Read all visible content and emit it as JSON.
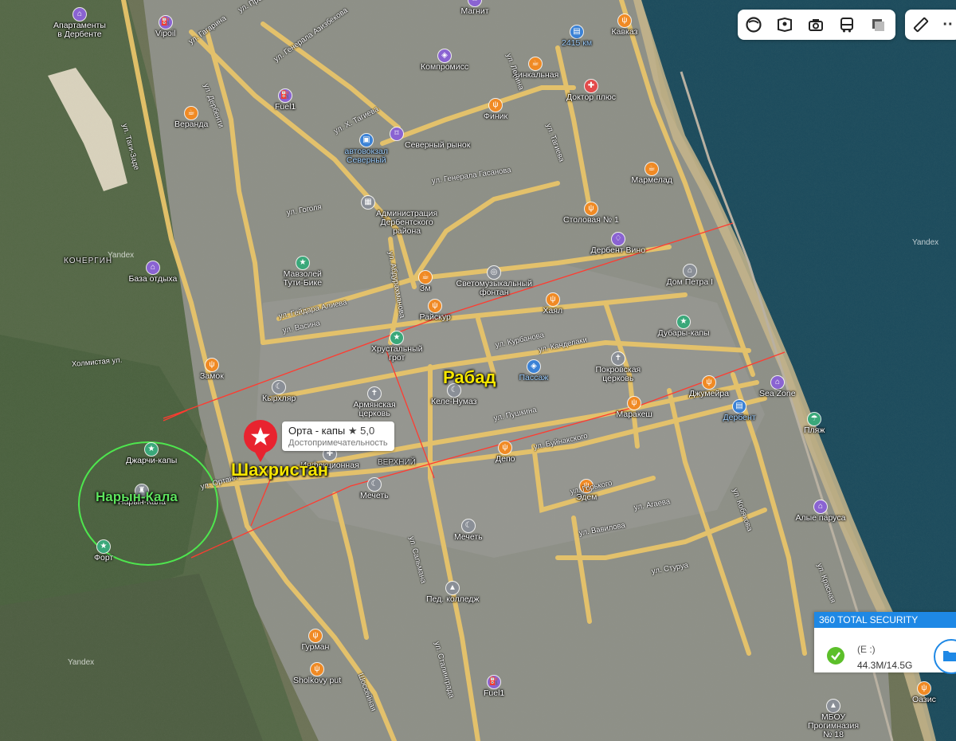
{
  "map": {
    "watermark": "Yandex",
    "districts": [
      {
        "id": "shahristan",
        "text": "Шахристан",
        "color": "#f5e600"
      },
      {
        "id": "rabad",
        "text": "Рабад",
        "color": "#f5e600"
      },
      {
        "id": "naryn",
        "text": "Нарын-Кала",
        "color": "#5ee35e"
      }
    ],
    "marker": {
      "name": "Орта - капы",
      "rating": "★ 5,0",
      "category": "Достопримечательность"
    },
    "areas": {
      "kochergin": "КОЧЕРГИН",
      "verkhniy": "ВЕРХНИЙ"
    },
    "pois": [
      {
        "id": "apartamenty",
        "text": "Апартаменты\nв Дербенте",
        "color": "purple",
        "icon": "bed-icon"
      },
      {
        "id": "vipoil",
        "text": "Vipoil",
        "color": "purple",
        "icon": "fuel-icon"
      },
      {
        "id": "magnit",
        "text": "Магнит",
        "color": "purple",
        "icon": "cart-icon"
      },
      {
        "id": "kavkaz",
        "text": "Кавказ",
        "color": "orange",
        "icon": "fork-icon"
      },
      {
        "id": "km",
        "text": "2415 км",
        "color": "blue",
        "icon": "rail-icon"
      },
      {
        "id": "kompromiss",
        "text": "Компромисс",
        "color": "purple",
        "icon": "shop-icon"
      },
      {
        "id": "khinkalnaya",
        "text": "Хинкальная",
        "color": "orange",
        "icon": "cafe-icon"
      },
      {
        "id": "doktor",
        "text": "Доктор плюс",
        "color": "red",
        "icon": "health-icon"
      },
      {
        "id": "fuel1",
        "text": "Fuel1",
        "color": "purple",
        "icon": "fuel-icon"
      },
      {
        "id": "veranda",
        "text": "Веранда",
        "color": "orange",
        "icon": "cafe-icon"
      },
      {
        "id": "finik",
        "text": "Финик",
        "color": "orange",
        "icon": "fork-icon"
      },
      {
        "id": "severny_rynok",
        "text": "Северный рынок",
        "color": "purple",
        "icon": "cart-icon"
      },
      {
        "id": "avtovokzal",
        "text": "автовокзал\nСеверный",
        "color": "blue",
        "icon": "bus-icon"
      },
      {
        "id": "mermelad",
        "text": "Мармелад",
        "color": "orange",
        "icon": "cafe-icon"
      },
      {
        "id": "administraciya",
        "text": "Администрация\nДербентского\nрайона",
        "color": "gray",
        "icon": "building-icon"
      },
      {
        "id": "stolovaya",
        "text": "Столовая № 1",
        "color": "orange",
        "icon": "fork-icon"
      },
      {
        "id": "derbent_vino",
        "text": "Дербент Вино",
        "color": "purple",
        "icon": "wine-icon"
      },
      {
        "id": "mavzoley",
        "text": "Мавзолей\nТути-Бике",
        "color": "teal",
        "icon": "star-icon"
      },
      {
        "id": "baza",
        "text": "База отдыха",
        "color": "purple",
        "icon": "bed-icon"
      },
      {
        "id": "zm",
        "text": "Зм",
        "color": "orange",
        "icon": "cafe-icon"
      },
      {
        "id": "svetomuz",
        "text": "Светомузыкальный\nфонтан",
        "color": "gray",
        "icon": "fountain-icon"
      },
      {
        "id": "dom_petra",
        "text": "Дом Петра I",
        "color": "gray",
        "icon": "museum-icon"
      },
      {
        "id": "raykur",
        "text": "Райскур",
        "color": "orange",
        "icon": "fork-icon"
      },
      {
        "id": "khayal",
        "text": "Хаял",
        "color": "orange",
        "icon": "fork-icon"
      },
      {
        "id": "dubary",
        "text": "Дубары-капы",
        "color": "teal",
        "icon": "star-icon"
      },
      {
        "id": "khrustal",
        "text": "Хрустальный\nгрот",
        "color": "teal",
        "icon": "star-icon"
      },
      {
        "id": "pokrov",
        "text": "Покровская\nцерковь",
        "color": "gray",
        "icon": "church-icon"
      },
      {
        "id": "passazh",
        "text": "Пассаж",
        "color": "blue",
        "icon": "shop-icon"
      },
      {
        "id": "zamok",
        "text": "Замок",
        "color": "orange",
        "icon": "fork-icon"
      },
      {
        "id": "kyrkhlyar",
        "text": "Кырхляр",
        "color": "gray",
        "icon": "mosque-icon"
      },
      {
        "id": "armyan",
        "text": "Армянская\nцерковь",
        "color": "gray",
        "icon": "church-icon"
      },
      {
        "id": "kele",
        "text": "Келе-Нумаз",
        "color": "gray",
        "icon": "mosque-icon"
      },
      {
        "id": "dzhumeira",
        "text": "Джумейра",
        "color": "orange",
        "icon": "fork-icon"
      },
      {
        "id": "seazone",
        "text": "Sea Zone",
        "color": "purple",
        "icon": "bed-icon"
      },
      {
        "id": "derbent_st",
        "text": "Дербент",
        "color": "blue",
        "icon": "rail-icon"
      },
      {
        "id": "maraksh",
        "text": "Маракеш",
        "color": "orange",
        "icon": "fork-icon"
      },
      {
        "id": "plyazh",
        "text": "Пляж",
        "color": "teal",
        "icon": "beach-icon"
      },
      {
        "id": "dzharchi",
        "text": "Джарчи-капы",
        "color": "teal",
        "icon": "star-icon"
      },
      {
        "id": "naryn_poi",
        "text": "Нарын-Кала",
        "color": "gray",
        "icon": "castle-icon"
      },
      {
        "id": "fort",
        "text": "Форт",
        "color": "teal",
        "icon": "star-icon"
      },
      {
        "id": "infek",
        "text": "Инфекционная",
        "color": "gray",
        "icon": "hospital-icon"
      },
      {
        "id": "depo",
        "text": "Депо",
        "color": "orange",
        "icon": "fork-icon"
      },
      {
        "id": "mechet1",
        "text": "Мечеть",
        "color": "gray",
        "icon": "mosque-icon"
      },
      {
        "id": "edem",
        "text": "Эдем",
        "color": "orange",
        "icon": "fork-icon"
      },
      {
        "id": "mechet2",
        "text": "Мечеть",
        "color": "gray",
        "icon": "mosque-icon"
      },
      {
        "id": "alye",
        "text": "Алые паруса",
        "color": "purple",
        "icon": "bed-icon"
      },
      {
        "id": "ped",
        "text": "Пед. колледж",
        "color": "gray",
        "icon": "school-icon"
      },
      {
        "id": "gurman",
        "text": "Гурман",
        "color": "orange",
        "icon": "fork-icon"
      },
      {
        "id": "sholkovy",
        "text": "Sholkovy put",
        "color": "orange",
        "icon": "fork-icon"
      },
      {
        "id": "fuel1b",
        "text": "Fuel1",
        "color": "purple",
        "icon": "fuel-icon"
      },
      {
        "id": "oazis",
        "text": "Оазис",
        "color": "orange",
        "icon": "fork-icon"
      },
      {
        "id": "mbou",
        "text": "МБОУ\nПрогимназия\n№ 18",
        "color": "gray",
        "icon": "school-icon"
      }
    ],
    "streets": [
      {
        "id": "s1",
        "text": "ул. Гагарина"
      },
      {
        "id": "s2",
        "text": "ул. Промышленная"
      },
      {
        "id": "s3",
        "text": "ул. Генерала Азизбекова"
      },
      {
        "id": "s4",
        "text": "ул. Ленина"
      },
      {
        "id": "s5",
        "text": "ул. Х. Тагиева"
      },
      {
        "id": "s6",
        "text": "ул. Тагиева"
      },
      {
        "id": "s7",
        "text": "ул. Дербенти"
      },
      {
        "id": "s8",
        "text": "ул. Гейдара Алиева"
      },
      {
        "id": "s9",
        "text": "ул. Гоголя"
      },
      {
        "id": "s10",
        "text": "ул. Васина"
      },
      {
        "id": "s11",
        "text": "ул. Курбанова"
      },
      {
        "id": "s12",
        "text": "ул. Канделаки"
      },
      {
        "id": "s13",
        "text": "ул. Пушкина"
      },
      {
        "id": "s14",
        "text": "ул. Буйнакского"
      },
      {
        "id": "s15",
        "text": "ул. Горького"
      },
      {
        "id": "s16",
        "text": "ул. Агаева"
      },
      {
        "id": "s17",
        "text": "ул. Вавилова"
      },
      {
        "id": "s18",
        "text": "ул. Стуруа"
      },
      {
        "id": "s19",
        "text": "Шоссейная"
      },
      {
        "id": "s20",
        "text": "Холмистая ул."
      },
      {
        "id": "s21",
        "text": "ул. Ортаня"
      },
      {
        "id": "s22",
        "text": "ул. Кобякова"
      },
      {
        "id": "s23",
        "text": "ул. Красная"
      },
      {
        "id": "s24",
        "text": "ул. Генерала Гасанова"
      },
      {
        "id": "s25",
        "text": "ул. Таги-Заде"
      },
      {
        "id": "s26",
        "text": "ул. Сальмана"
      },
      {
        "id": "s27",
        "text": "ул. Сталинграда"
      },
      {
        "id": "s28",
        "text": "ул. Абдурахманова"
      }
    ]
  },
  "toolbar": {
    "buttons": [
      {
        "id": "layers",
        "icon": "layers-icon"
      },
      {
        "id": "panorama",
        "icon": "panorama-icon"
      },
      {
        "id": "photo",
        "icon": "camera-icon"
      },
      {
        "id": "transport",
        "icon": "bus-icon"
      },
      {
        "id": "traffic",
        "icon": "traffic-icon"
      }
    ],
    "ruler": "ruler-icon",
    "more": "··"
  },
  "security": {
    "title": "360 TOTAL SECURITY",
    "drive": "(E :)",
    "usage": "44.3M/14.5G"
  },
  "colors": {
    "sea": "#1a4a5c",
    "land": "#5e6a4e",
    "city": "#8d8e86",
    "road": "#f0c96a",
    "line": "#ff3b30",
    "circle": "#4ee64e"
  }
}
